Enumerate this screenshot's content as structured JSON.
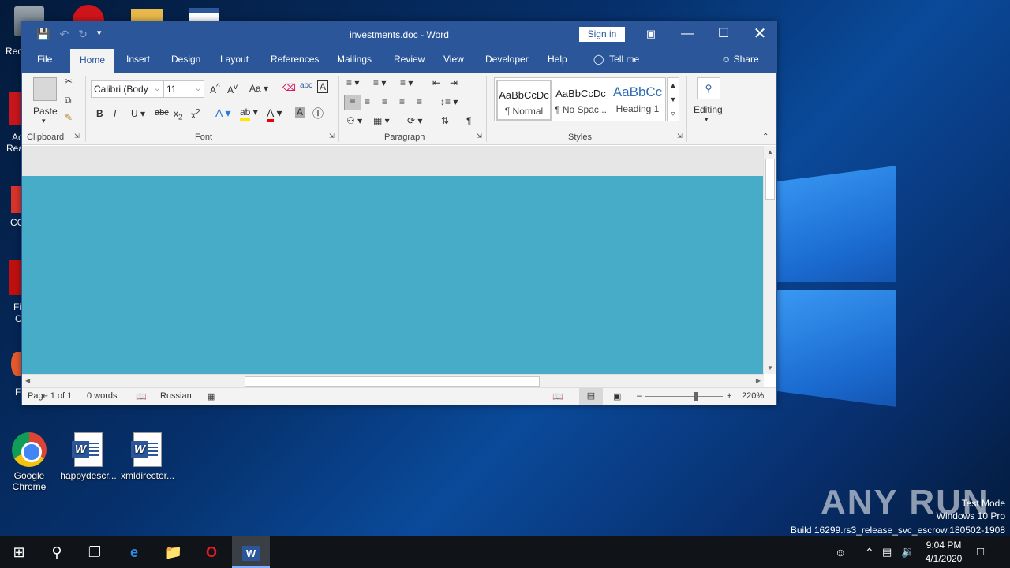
{
  "desktop": {
    "icons": [
      {
        "label_line1": "Google",
        "label_line2": "Chrome",
        "icon": "chrome-icon"
      },
      {
        "label_line1": "happydescr...",
        "icon": "word-doc-icon"
      },
      {
        "label_line1": "xmldirector...",
        "icon": "word-doc-icon"
      }
    ],
    "partial_labels": [
      "Rec",
      "Ac",
      "Rea",
      "CC",
      "Fi",
      "C",
      "F"
    ],
    "watermark": {
      "line1": "Test Mode",
      "line2": "Windows 10 Pro",
      "line3": "Build 16299.rs3_release_svc_escrow.180502-1908"
    },
    "anyrun_logo": "ANY RUN"
  },
  "word": {
    "title": "investments.doc  -  Word",
    "sign_in": "Sign in",
    "tabs": [
      "File",
      "Home",
      "Insert",
      "Design",
      "Layout",
      "References",
      "Mailings",
      "Review",
      "View",
      "Developer",
      "Help",
      "Tell me"
    ],
    "active_tab": "Home",
    "share": "Share",
    "ribbon": {
      "clipboard": {
        "paste": "Paste",
        "label": "Clipboard"
      },
      "font": {
        "font_name": "Calibri (Body",
        "font_size": "11",
        "label": "Font",
        "change_case": "Aa"
      },
      "paragraph": {
        "label": "Paragraph"
      },
      "styles": {
        "label": "Styles",
        "items": [
          {
            "preview": "AaBbCcDc",
            "name": "¶ Normal"
          },
          {
            "preview": "AaBbCcDc",
            "name": "¶ No Spac..."
          },
          {
            "preview": "AaBbCc",
            "name": "Heading 1"
          }
        ]
      },
      "editing": {
        "label": "Editing"
      }
    },
    "status": {
      "page": "Page 1 of 1",
      "words": "0 words",
      "language": "Russian",
      "zoom": "220%"
    },
    "colors": {
      "accent": "#2b579a",
      "page": "#46acc8"
    }
  },
  "taskbar": {
    "time": "9:04 PM",
    "date": "4/1/2020"
  }
}
